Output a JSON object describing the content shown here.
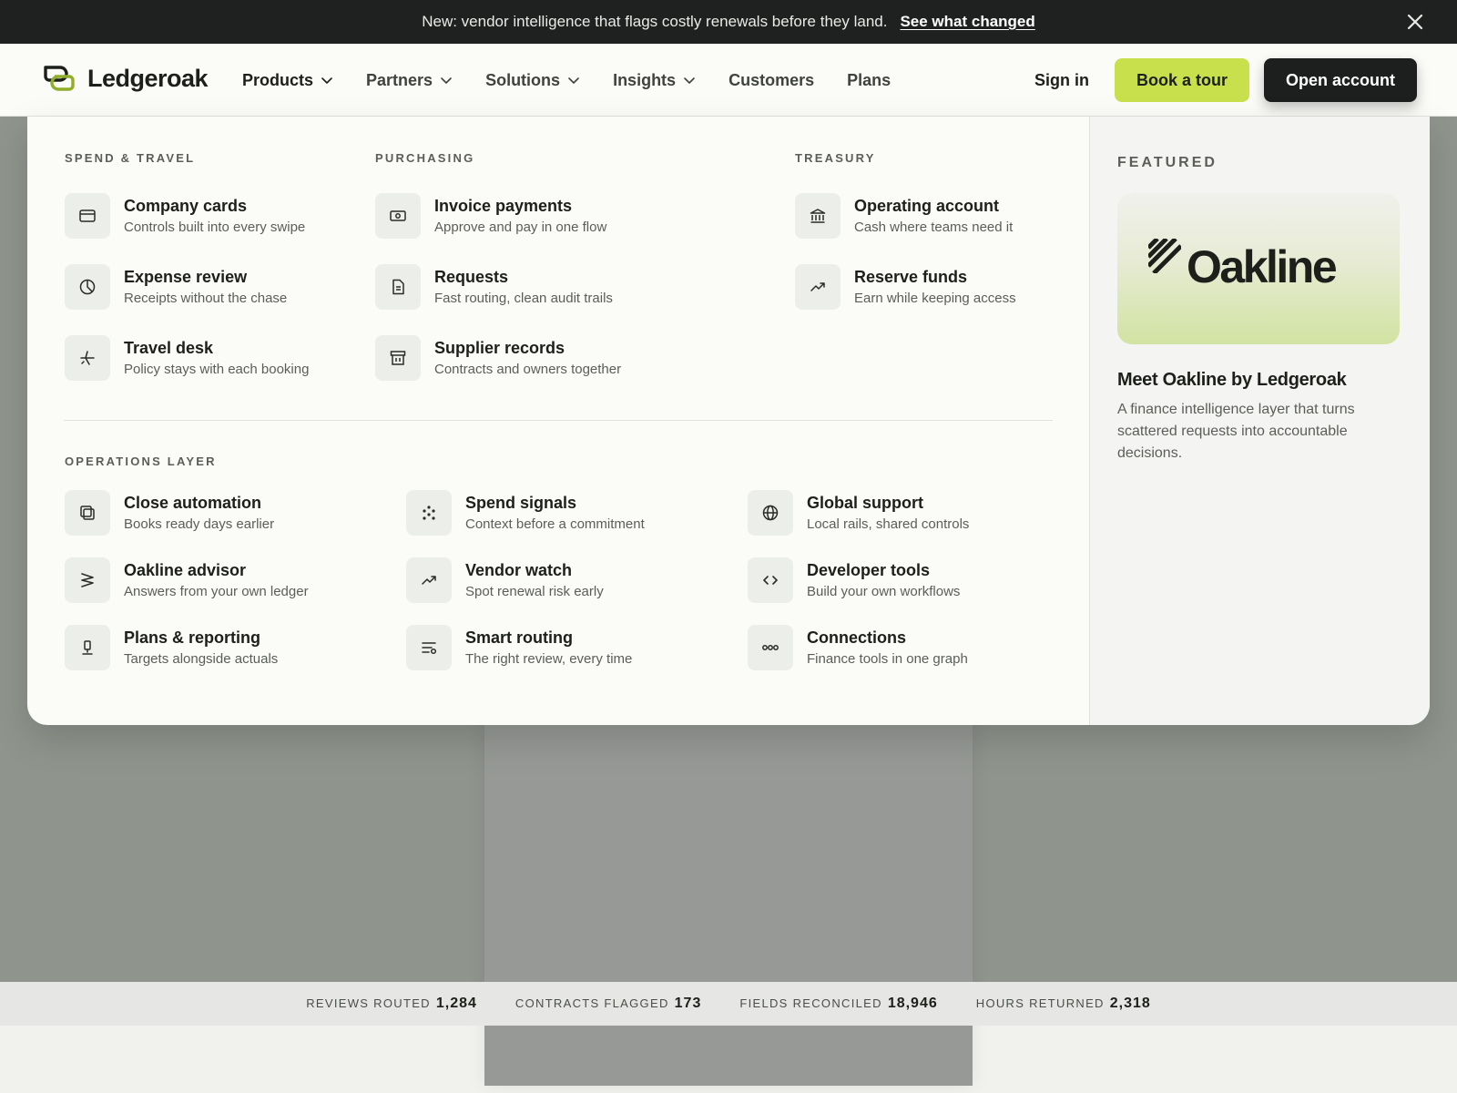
{
  "announcement": {
    "message": "New: vendor intelligence that flags costly renewals before they land.",
    "link": "See what changed",
    "close_icon": "close-icon"
  },
  "header": {
    "brand": "Ledgeroak",
    "nav": [
      {
        "label": "Products",
        "has_dropdown": true,
        "active": true
      },
      {
        "label": "Partners",
        "has_dropdown": true
      },
      {
        "label": "Solutions",
        "has_dropdown": true
      },
      {
        "label": "Insights",
        "has_dropdown": true
      },
      {
        "label": "Customers",
        "has_dropdown": false
      },
      {
        "label": "Plans",
        "has_dropdown": false
      }
    ],
    "signin": "Sign in",
    "tour_button": "Book a tour",
    "open_button": "Open account"
  },
  "menu": {
    "sections": [
      {
        "label": "SPEND & TRAVEL",
        "items": [
          {
            "title": "Company cards",
            "subtitle": "Controls built into every swipe",
            "icon": "card-icon"
          },
          {
            "title": "Expense review",
            "subtitle": "Receipts without the chase",
            "icon": "pie-chart-icon"
          },
          {
            "title": "Travel desk",
            "subtitle": "Policy stays with each booking",
            "icon": "plane-icon"
          }
        ]
      },
      {
        "label": "PURCHASING",
        "items": [
          {
            "title": "Invoice payments",
            "subtitle": "Approve and pay in one flow",
            "icon": "banknote-icon"
          },
          {
            "title": "Requests",
            "subtitle": "Fast routing, clean audit trails",
            "icon": "document-icon"
          },
          {
            "title": "Supplier records",
            "subtitle": "Contracts and owners together",
            "icon": "archive-icon"
          }
        ]
      },
      {
        "label": "TREASURY",
        "items": [
          {
            "title": "Operating account",
            "subtitle": "Cash where teams need it",
            "icon": "bank-icon"
          },
          {
            "title": "Reserve funds",
            "subtitle": "Earn while keeping access",
            "icon": "trend-up-icon"
          }
        ]
      },
      {
        "label": "OPERATIONS LAYER",
        "items": [
          {
            "title": "Close automation",
            "subtitle": "Books ready days earlier",
            "icon": "stack-icon"
          },
          {
            "title": "Oakline advisor",
            "subtitle": "Answers from your own ledger",
            "icon": "sigma-icon"
          },
          {
            "title": "Plans & reporting",
            "subtitle": "Targets alongside actuals",
            "icon": "pin-icon"
          },
          {
            "title": "Spend signals",
            "subtitle": "Context before a commitment",
            "icon": "dots-icon"
          },
          {
            "title": "Vendor watch",
            "subtitle": "Spot renewal risk early",
            "icon": "trend-up-icon"
          },
          {
            "title": "Smart routing",
            "subtitle": "The right review, every time",
            "icon": "routing-icon"
          },
          {
            "title": "Global support",
            "subtitle": "Local rails, shared controls",
            "icon": "globe-icon"
          },
          {
            "title": "Developer tools",
            "subtitle": "Build your own workflows",
            "icon": "code-icon"
          },
          {
            "title": "Connections",
            "subtitle": "Finance tools in one graph",
            "icon": "connections-icon"
          }
        ]
      }
    ],
    "featured": {
      "label": "FEATURED",
      "card_wordmark": "Oakline",
      "title": "Meet Oakline by Ledgeroak",
      "description": "A finance intelligence layer that turns scattered requests into accountable decisions."
    }
  },
  "stats": [
    {
      "label": "REVIEWS ROUTED",
      "value": "1,284"
    },
    {
      "label": "CONTRACTS FLAGGED",
      "value": "173"
    },
    {
      "label": "FIELDS RECONCILED",
      "value": "18,946"
    },
    {
      "label": "HOURS RETURNED",
      "value": "2,318"
    }
  ],
  "colors": {
    "accent": "#c7e04b",
    "dark": "#1d1f1e",
    "announcement_bg": "#1f2120",
    "backdrop": "#8f948d"
  }
}
